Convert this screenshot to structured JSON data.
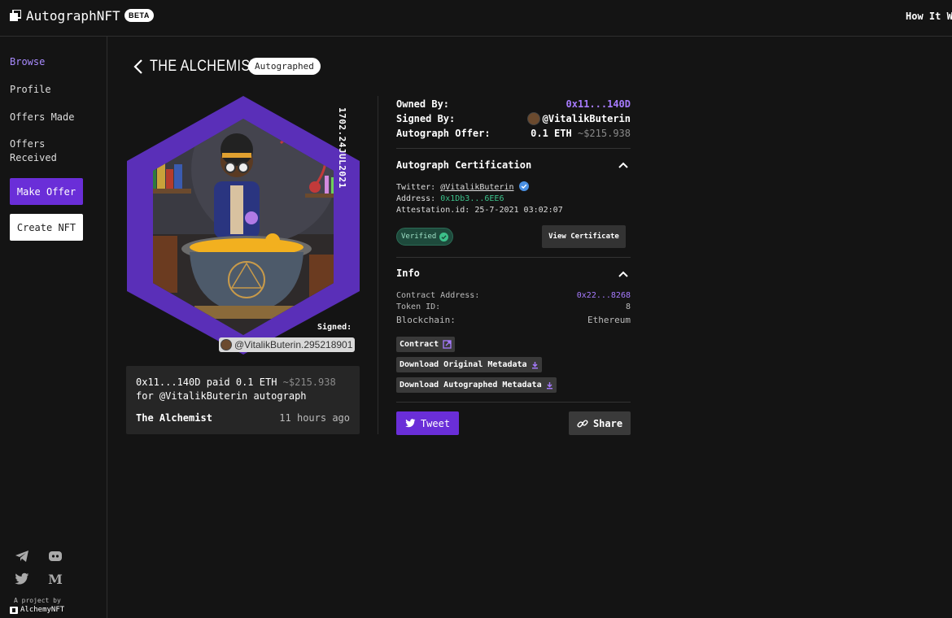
{
  "header": {
    "brand": "AutographNFT",
    "badge": "BETA",
    "how_it_works": "How It Wo"
  },
  "sidebar": {
    "items": [
      {
        "label": "Browse",
        "active": true
      },
      {
        "label": "Profile"
      },
      {
        "label": "Offers Made"
      },
      {
        "label": "Offers Received"
      }
    ],
    "make_offer": "Make Offer",
    "create_nft": "Create NFT",
    "social_icons": [
      "telegram-icon",
      "discord-icon",
      "twitter-icon",
      "medium-icon"
    ],
    "project_by": "A project by",
    "alchemy": "AlchemyNFT"
  },
  "nft": {
    "title": "THE ALCHEMIST",
    "tag": "Autographed",
    "edition_text": "1702.24JUL2021",
    "signed_label": "Signed:",
    "signed_handle": "@VitalikButerin.295218901"
  },
  "activity": {
    "owner": "0x11...140D",
    "action": "paid",
    "amount": "0.1 ETH",
    "usd": "~$215.938",
    "purpose": "for @VitalikButerin autograph",
    "name": "The Alchemist",
    "time": "11 hours ago"
  },
  "details": {
    "owned_by_label": "Owned By:",
    "owned_by": "0x11...140D",
    "signed_by_label": "Signed By:",
    "signed_by": "@VitalikButerin",
    "offer_label": "Autograph Offer:",
    "offer_eth": "0.1 ETH",
    "offer_usd": "~$215.938"
  },
  "certification": {
    "title": "Autograph Certification",
    "twitter_label": "Twitter:",
    "twitter": "@VitalikButerin",
    "address_label": "Address:",
    "address": "0x1Db3...6EE6",
    "attestation_label": "Attestation.id:",
    "attestation": "25-7-2021 03:02:07",
    "verified": "Verified",
    "view_certificate": "View Certificate"
  },
  "info": {
    "title": "Info",
    "contract_address_label": "Contract Address:",
    "contract_address": "0x22...8268",
    "token_id_label": "Token ID:",
    "token_id": "8",
    "blockchain_label": "Blockchain:",
    "blockchain": "Ethereum",
    "contract_link": "Contract",
    "download_original": "Download Original Metadata",
    "download_autographed": "Download Autographed Metadata"
  },
  "actions": {
    "tweet": "Tweet",
    "share": "Share"
  },
  "colors": {
    "accent": "#6a2ed8",
    "purple_text": "#a77bff",
    "verified_green": "#3cc08a",
    "hex_frame": "#5a2fb8"
  }
}
